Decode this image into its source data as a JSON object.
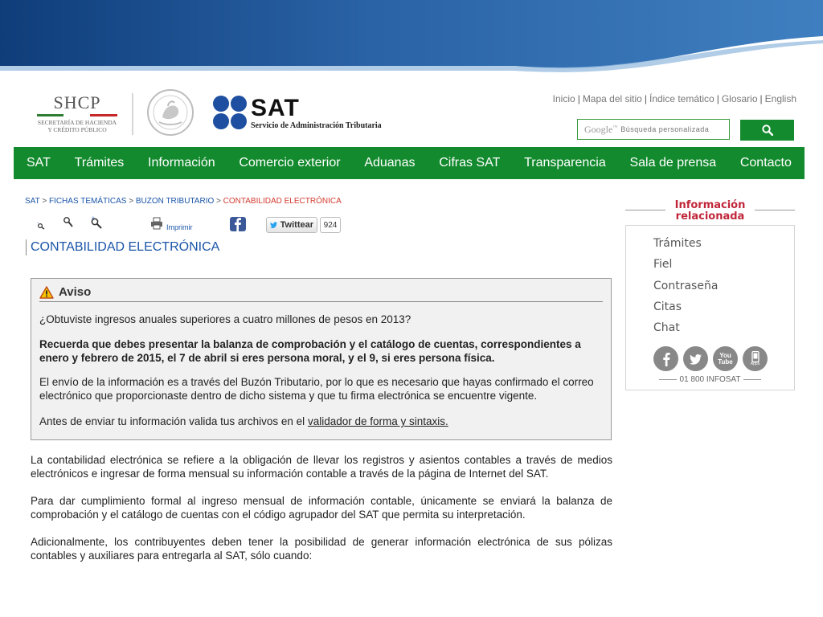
{
  "colors": {
    "nav_green": "#138a2e",
    "link_blue": "#1a55a8",
    "breadcrumb_current": "#d23b2f",
    "side_title_red": "#c0273a"
  },
  "header": {
    "shcp": {
      "name": "SHCP",
      "subtitle_line1": "Secretaría de Hacienda",
      "subtitle_line2": "y Crédito Público"
    },
    "sat": {
      "name": "SAT",
      "subtitle": "Servicio de Administración Tributaria"
    },
    "top_links": [
      "Inicio",
      "Mapa del sitio",
      "Índice temático",
      "Glosario",
      "English"
    ],
    "search": {
      "brand": "Google",
      "placeholder": "Búsqueda personalizada",
      "button_icon": "search-icon"
    }
  },
  "nav": [
    "SAT",
    "Trámites",
    "Información",
    "Comercio exterior",
    "Aduanas",
    "Cifras SAT",
    "Transparencia",
    "Sala de prensa",
    "Contacto"
  ],
  "breadcrumb": {
    "items": [
      "SAT",
      "FICHAS TEMÁTICAS",
      "BUZON TRIBUTARIO"
    ],
    "current": "CONTABILIDAD ELECTRÓNICA",
    "separator": ">"
  },
  "tools": {
    "icons": [
      "zoom-out-icon",
      "zoom-reset-icon",
      "zoom-in-icon",
      "printer-icon",
      "facebook-icon",
      "twitter-icon"
    ],
    "print_label": "Imprimir",
    "twitter_label": "Twittear",
    "twitter_count": "924"
  },
  "page_title": "CONTABILIDAD ELECTRÓNICA",
  "aviso": {
    "title": "Aviso",
    "question": "¿Obtuviste ingresos anuales superiores a cuatro millones de pesos en 2013?",
    "reminder": "Recuerda que debes presentar la balanza de comprobación y el catálogo de cuentas, correspondientes a enero y febrero de 2015, el 7 de abril si eres persona moral, y el 9, si eres persona física.",
    "envio": "El envío de la información es a través del Buzón Tributario, por lo que es necesario que hayas confirmado el correo electrónico que proporcionaste dentro de dicho sistema y que tu firma electrónica se encuentre vigente.",
    "antes_prefix": "Antes de enviar tu información valida tus archivos en el ",
    "antes_link": "validador de forma y sintaxis."
  },
  "body": [
    "La contabilidad electrónica se refiere a la obligación de llevar los registros y asientos contables a través de medios electrónicos e ingresar de forma mensual su información contable a través de la página de Internet del SAT.",
    "Para dar cumplimiento formal al ingreso mensual de información contable, únicamente se enviará la balanza de comprobación y el catálogo de cuentas con el código agrupador del SAT que permita su interpretación.",
    "Adicionalmente, los contribuyentes deben tener la posibilidad de generar información electrónica de sus pólizas contables y auxiliares para entregarla al SAT, sólo cuando:"
  ],
  "sidebar": {
    "title_line1": "Información",
    "title_line2": "relacionada",
    "links": [
      "Trámites",
      "Fiel",
      "Contraseña",
      "Citas",
      "Chat"
    ],
    "social": [
      "facebook-icon",
      "twitter-icon",
      "youtube-icon",
      "apps-icon"
    ],
    "youtube_label": "You Tube",
    "apps_label": "Apps",
    "phone": "01 800 INFOSAT"
  }
}
